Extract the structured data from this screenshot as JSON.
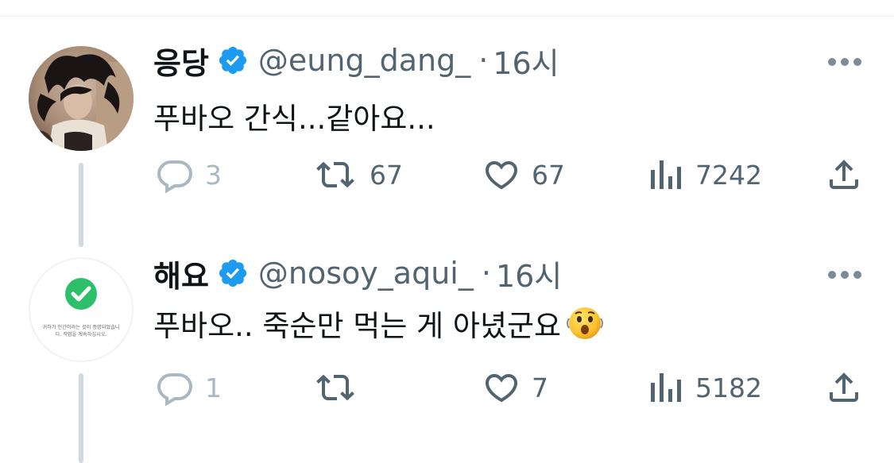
{
  "tweets": [
    {
      "display_name": "응당",
      "handle": "@eung_dang_",
      "separator": "·",
      "time": "16시",
      "text": "푸바오 간식...같아요...",
      "replies": "3",
      "retweets": "67",
      "likes": "67",
      "views": "7242",
      "avatar_icon": "dark-hair-photo-avatar"
    },
    {
      "display_name": "해요",
      "handle": "@nosoy_aqui_",
      "separator": "·",
      "time": "16시",
      "text": "푸바오.. 죽순만 먹는 게 아녔군요",
      "emoji_icon": "hushed-face-emoji",
      "replies": "1",
      "retweets": "",
      "likes": "7",
      "views": "5182",
      "avatar_icon": "green-check-avatar",
      "avatar_caption_line1": "귀하가 인간이라는 것이 증명되었습니",
      "avatar_caption_line2": "다. 작업을 계속하십시오."
    }
  ],
  "colors": {
    "verified_blue": "#1d9bf0",
    "secondary_text": "#536471",
    "thread_line": "#cfd9de",
    "check_green": "#2dbf6a"
  },
  "icons": {
    "reply": "reply-bubble-icon",
    "retweet": "retweet-icon",
    "like": "heart-icon",
    "views": "views-bar-chart-icon",
    "share": "share-upload-icon",
    "more": "more-dots-icon",
    "verified": "verified-badge-icon"
  }
}
